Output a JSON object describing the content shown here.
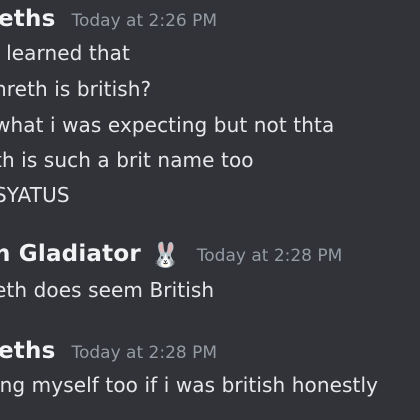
{
  "messages": [
    {
      "author": "eths",
      "timestamp": "Today at 2:26 PM",
      "lines": [
        "i learned that",
        "nreth is british?",
        "what i was expecting but not thta",
        "th is such a brit name too",
        "SYATUS"
      ]
    },
    {
      "author": "n Gladiator",
      "badge_icon": "🐰",
      "timestamp": "Today at 2:28 PM",
      "lines": [
        "eth does seem British"
      ]
    },
    {
      "author": "eths",
      "timestamp": "Today at 2:28 PM",
      "lines": [
        "ing myself too if i was british honestly"
      ]
    }
  ]
}
